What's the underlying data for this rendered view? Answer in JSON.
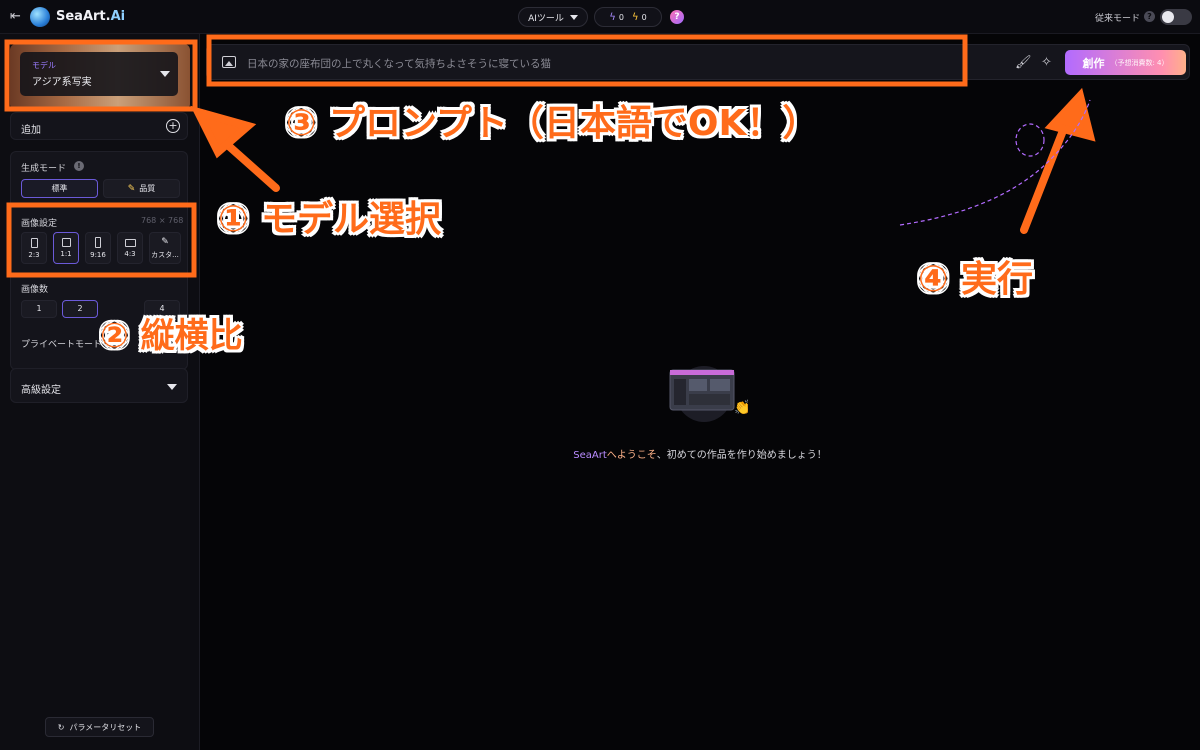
{
  "topbar": {
    "brand_main": "SeaArt.",
    "brand_ai": "Ai",
    "ai_tools": "AIツール",
    "credit_a": "0",
    "credit_b": "0",
    "help": "?",
    "legacy_mode": "従来モード",
    "legacy_help": "?"
  },
  "sidebar": {
    "model_label": "モデル",
    "model_name": "アジア系写実",
    "add_label": "追加",
    "gen_mode_label": "生成モード",
    "mode_standard": "標準",
    "mode_quality": "品質",
    "image_settings_label": "画像設定",
    "resolution": "768 × 768",
    "ratios": [
      "2:3",
      "1:1",
      "9:16",
      "4:3",
      "カスタ..."
    ],
    "image_count_label": "画像数",
    "counts": [
      "1",
      "2",
      "4"
    ],
    "private_mode_label": "プライベートモード",
    "advanced_label": "高級設定",
    "reset_label": "パラメータリセット"
  },
  "prompt": {
    "text": "日本の家の座布団の上で丸くなって気持ちよさそうに寝ている猫",
    "create_label": "創作",
    "create_cost": "（予想消費数: 4）"
  },
  "empty_state": {
    "brand": "SeaArt",
    "welcome": "へようこそ",
    "message": "、初めての作品を作り始めましょう！"
  },
  "annotations": {
    "a1": "① モデル選択",
    "a2": "② 縦横比",
    "a3": "③ プロンプト（日本語でOK！）",
    "a4": "④ 実行"
  },
  "colors": {
    "accent_orange": "#ff6b1a",
    "accent_purple": "#6b5ad8",
    "create_gradient_start": "#b26bff",
    "create_gradient_end": "#ffb08a"
  }
}
